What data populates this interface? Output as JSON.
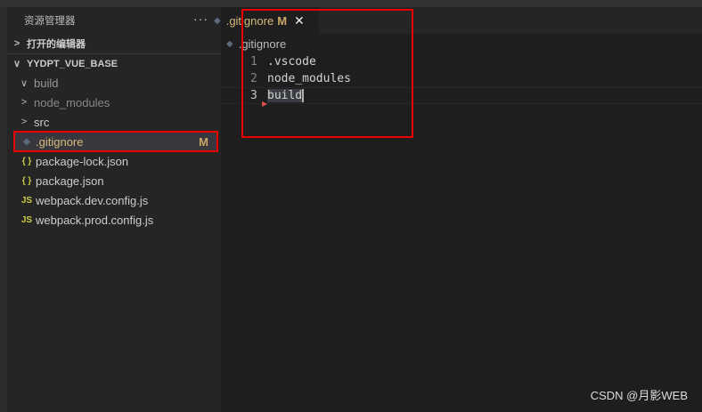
{
  "sidebar": {
    "title": "资源管理器",
    "more": "···",
    "open_editors": "打开的编辑器",
    "project": "YYDPT_VUE_BASE",
    "items": [
      {
        "label": "build",
        "type": "folder-open",
        "icon": "chevron-down"
      },
      {
        "label": "node_modules",
        "type": "folder",
        "icon": "chevron-right"
      },
      {
        "label": "src",
        "type": "folder",
        "icon": "chevron-right"
      },
      {
        "label": ".gitignore",
        "type": "file",
        "badge": "M"
      },
      {
        "label": "package-lock.json",
        "icon_text": "{ }"
      },
      {
        "label": "package.json",
        "icon_text": "{ }"
      },
      {
        "label": "webpack.dev.config.js",
        "icon_text": "JS"
      },
      {
        "label": "webpack.prod.config.js",
        "icon_text": "JS"
      }
    ]
  },
  "editor": {
    "tab": {
      "label": ".gitignore",
      "badge": "M",
      "close": "✕"
    },
    "breadcrumb": ".gitignore",
    "lines": [
      {
        "n": "1",
        "text": ".vscode"
      },
      {
        "n": "2",
        "text": "node_modules"
      },
      {
        "n": "3",
        "text": "build"
      }
    ]
  },
  "watermark": "CSDN @月影WEB"
}
